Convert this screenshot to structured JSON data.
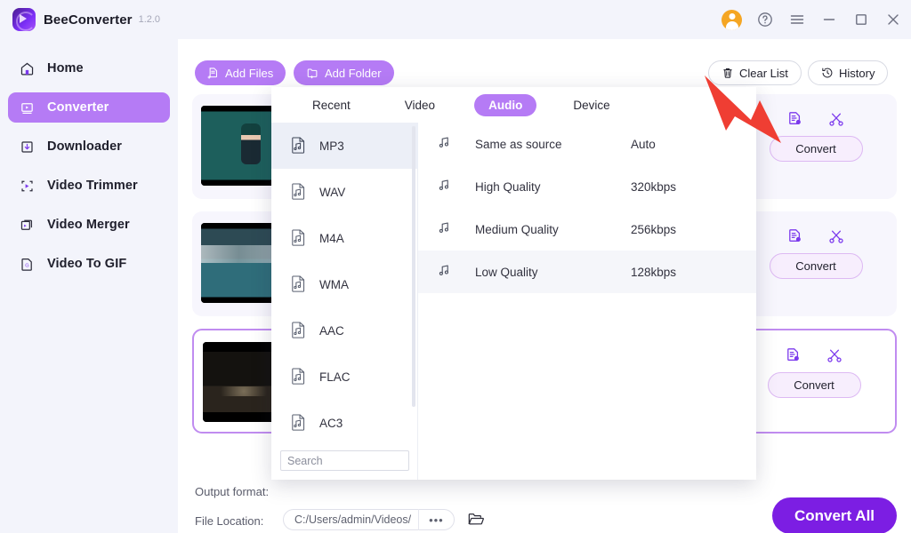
{
  "titlebar": {
    "app_name": "BeeConverter",
    "version": "1.2.0",
    "logo_icon": "bee-converter-logo-icon",
    "controls": [
      {
        "name": "account-avatar",
        "icon": "user-avatar-icon"
      },
      {
        "name": "help-button",
        "icon": "question-circle-icon"
      },
      {
        "name": "menu-button",
        "icon": "hamburger-menu-icon"
      },
      {
        "name": "minimize-button",
        "icon": "minimize-icon"
      },
      {
        "name": "maximize-button",
        "icon": "maximize-square-icon"
      },
      {
        "name": "close-button",
        "icon": "close-x-icon"
      }
    ]
  },
  "sidebar": {
    "items": [
      {
        "label": "Home",
        "icon": "home-icon",
        "active": false
      },
      {
        "label": "Converter",
        "icon": "converter-icon",
        "active": true
      },
      {
        "label": "Downloader",
        "icon": "download-icon",
        "active": false
      },
      {
        "label": "Video Trimmer",
        "icon": "trim-icon",
        "active": false
      },
      {
        "label": "Video Merger",
        "icon": "merge-icon",
        "active": false
      },
      {
        "label": "Video To GIF",
        "icon": "gif-icon",
        "active": false
      }
    ]
  },
  "toolbar": {
    "add_files_label": "Add Files",
    "add_files_icon": "add-file-icon",
    "add_folder_label": "Add Folder",
    "add_folder_icon": "add-folder-icon",
    "clear_list_label": "Clear List",
    "clear_list_icon": "trash-icon",
    "history_label": "History",
    "history_icon": "history-clock-icon"
  },
  "file_list": {
    "convert_label": "Convert",
    "settings_icon": "file-settings-icon",
    "trim_icon": "scissors-icon",
    "cards": [
      {
        "thumb": "thumbnail-hyde-me",
        "selected": false
      },
      {
        "thumb": "thumbnail-coastal-bay",
        "selected": false
      },
      {
        "thumb": "thumbnail-night-scene",
        "selected": true
      }
    ]
  },
  "dropdown": {
    "tabs": [
      {
        "label": "Recent",
        "active": false
      },
      {
        "label": "Video",
        "active": false
      },
      {
        "label": "Audio",
        "active": true
      },
      {
        "label": "Device",
        "active": false
      }
    ],
    "formats": [
      {
        "label": "MP3",
        "icon": "audio-file-icon",
        "active": true
      },
      {
        "label": "WAV",
        "icon": "audio-file-icon",
        "active": false
      },
      {
        "label": "M4A",
        "icon": "audio-file-icon",
        "active": false
      },
      {
        "label": "WMA",
        "icon": "audio-file-icon",
        "active": false
      },
      {
        "label": "AAC",
        "icon": "audio-file-icon",
        "active": false
      },
      {
        "label": "FLAC",
        "icon": "audio-file-icon",
        "active": false
      },
      {
        "label": "AC3",
        "icon": "audio-file-icon",
        "active": false
      }
    ],
    "search_placeholder": "Search",
    "search_value": "",
    "qualities": [
      {
        "name": "Same as source",
        "rate": "Auto",
        "icon": "music-note-icon",
        "active": false
      },
      {
        "name": "High Quality",
        "rate": "320kbps",
        "icon": "music-note-icon",
        "active": false
      },
      {
        "name": "Medium Quality",
        "rate": "256kbps",
        "icon": "music-note-icon",
        "active": false
      },
      {
        "name": "Low Quality",
        "rate": "128kbps",
        "icon": "music-note-icon",
        "active": true
      }
    ]
  },
  "bottom": {
    "output_format_label": "Output format:",
    "file_location_label": "File Location:",
    "file_location_value": "C:/Users/admin/Videos/",
    "browse_dots": "•••",
    "folder_icon": "open-folder-icon",
    "convert_all_label": "Convert All"
  },
  "annotation": {
    "arrow_icon": "red-pointer-arrow",
    "color": "#ef3e33"
  },
  "colors": {
    "accent_purple": "#b57bf5",
    "deep_purple": "#7c1ee3",
    "sidebar_bg": "#f3f4fb",
    "card_bg": "#f7f6fd",
    "selected_border": "#c08cf0"
  }
}
